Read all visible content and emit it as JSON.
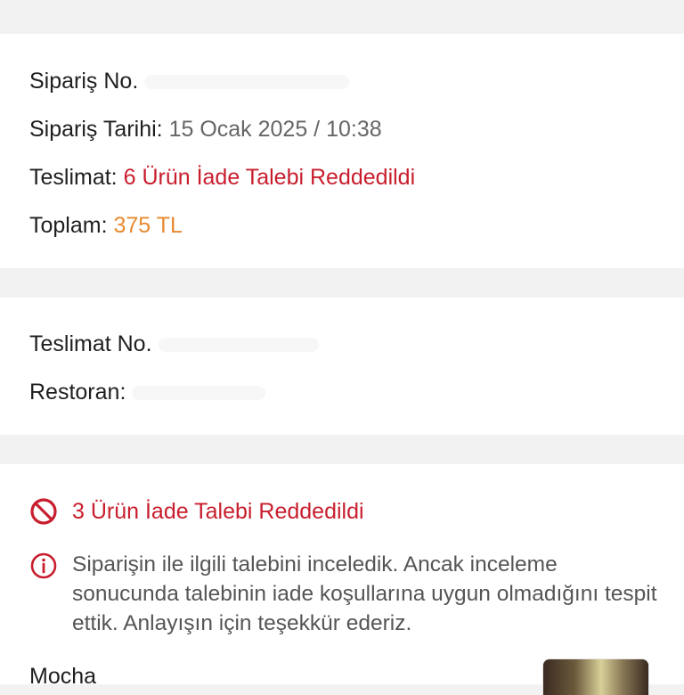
{
  "order": {
    "order_no_label": "Sipariş No.",
    "order_date_label": "Sipariş Tarihi:",
    "order_date_value": "15 Ocak 2025 / 10:38",
    "delivery_label": "Teslimat:",
    "delivery_value": "6 Ürün İade Talebi Reddedildi",
    "total_label": "Toplam:",
    "total_value": "375 TL"
  },
  "delivery": {
    "delivery_no_label": "Teslimat No.",
    "restaurant_label": "Restoran:"
  },
  "refund": {
    "status_text": "3 Ürün İade Talebi Reddedildi",
    "info_text": "Siparişin ile ilgili talebini inceledik. Ancak inceleme sonucunda talebinin iade koşullarına uygun olmadığını tespit ettik. Anlayışın için teşekkür ederiz.",
    "product_name": "Mocha"
  },
  "colors": {
    "accent_red": "#c81e2d",
    "total_orange": "#e8892f"
  },
  "icons": {
    "status": "prohibited-icon",
    "info": "info-circle-icon",
    "product": "product-thumbnail"
  }
}
